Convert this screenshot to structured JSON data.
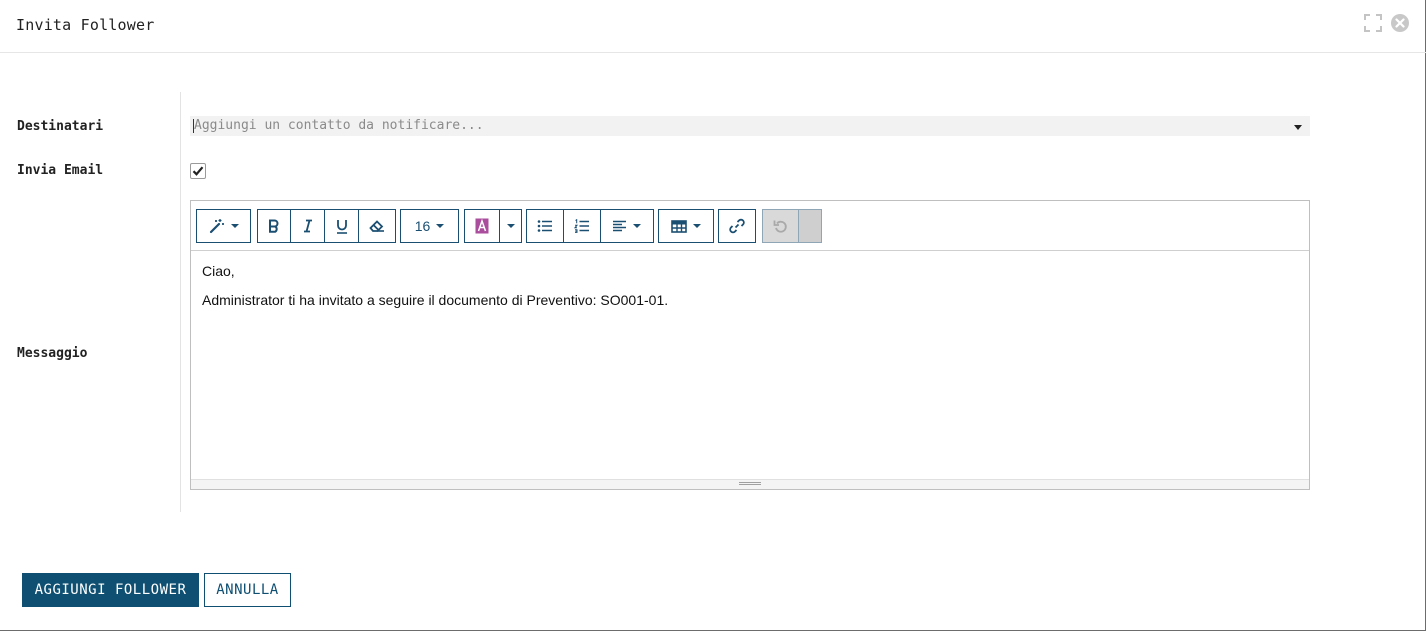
{
  "dialog": {
    "title": "Invita Follower",
    "expand_icon": "expand-icon",
    "close_icon": "close-icon"
  },
  "form": {
    "recipients_label": "Destinatari",
    "recipients_placeholder": "Aggiungi un contatto da notificare...",
    "send_email_label": "Invia Email",
    "send_email_checked": true,
    "message_label": "Messaggio"
  },
  "editor": {
    "toolbar": {
      "style_icon": "magic-wand-icon",
      "bold_icon": "bold-icon",
      "italic_icon": "italic-icon",
      "underline_icon": "underline-icon",
      "eraser_icon": "eraser-icon",
      "font_size": "16",
      "font_color_icon": "font-color-icon",
      "unordered_list_icon": "unordered-list-icon",
      "ordered_list_icon": "ordered-list-icon",
      "align_icon": "align-left-icon",
      "table_icon": "table-icon",
      "link_icon": "link-icon",
      "undo_icon": "undo-icon"
    },
    "lines": [
      "Ciao,",
      "Administrator ti ha invitato a seguire il documento di Preventivo: SO001-01."
    ]
  },
  "footer": {
    "primary_label": "AGGIUNGI FOLLOWER",
    "secondary_label": "ANNULLA"
  },
  "colors": {
    "primary": "#0e4f72",
    "toolbar_border": "#1b4f72",
    "font_color_accent": "#a94d9c"
  }
}
